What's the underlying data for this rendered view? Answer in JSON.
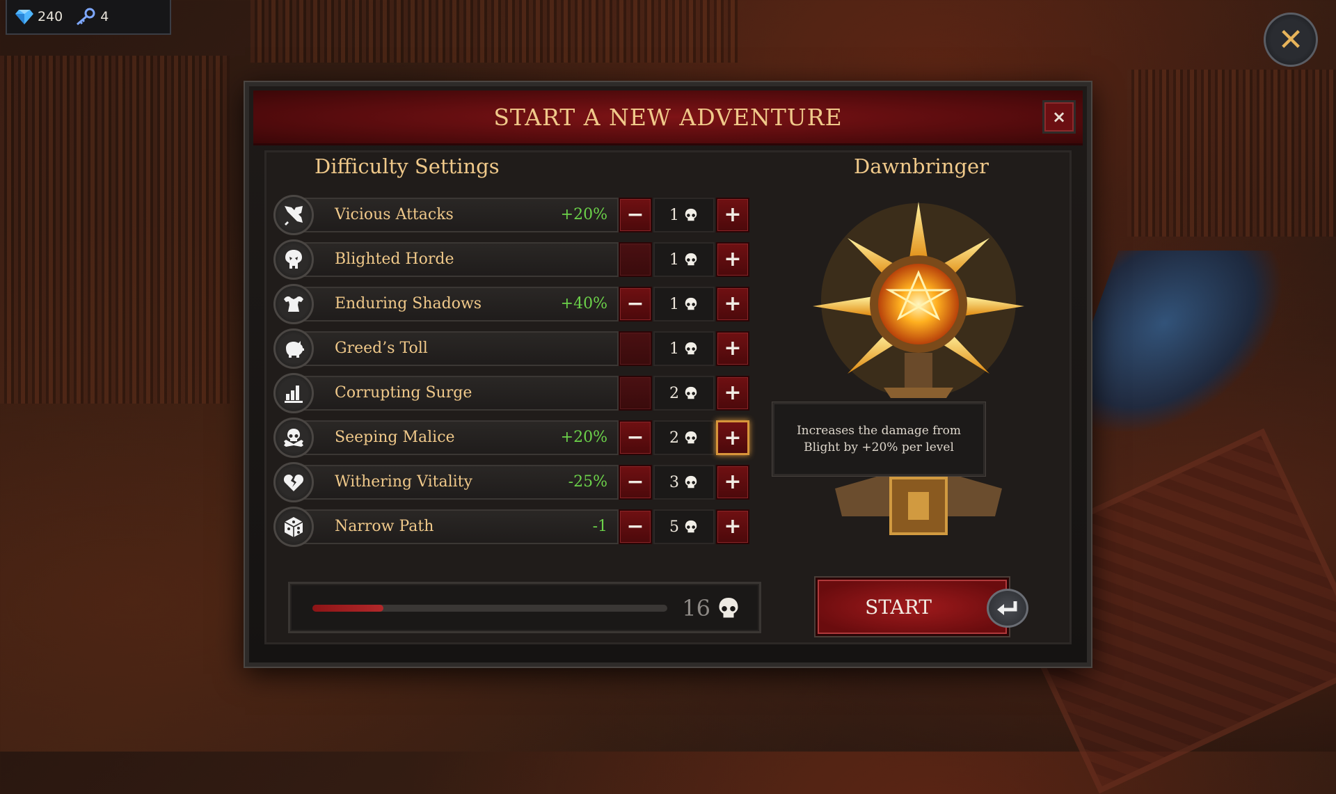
{
  "hud": {
    "gems": "240",
    "keys": "4"
  },
  "dialog": {
    "title": "START A NEW ADVENTURE",
    "close_label": "×",
    "difficulty_title": "Difficulty Settings",
    "artifact_title": "Dawnbringer",
    "tooltip": "Increases the damage from Blight by +20% per level",
    "total": "16",
    "progress": 0.2,
    "start_label": "START"
  },
  "outer_close_label": "✕",
  "settings": [
    {
      "icon": "crossed-swords-icon",
      "label": "Vicious Attacks",
      "value": "+20%",
      "level": "1",
      "minus_enabled": true,
      "selected": false
    },
    {
      "icon": "skull-mask-icon",
      "label": "Blighted Horde",
      "value": "",
      "level": "1",
      "minus_enabled": false,
      "selected": false
    },
    {
      "icon": "muscle-torso-icon",
      "label": "Enduring Shadows",
      "value": "+40%",
      "level": "1",
      "minus_enabled": true,
      "selected": false
    },
    {
      "icon": "piggy-bank-icon",
      "label": "Greed’s Toll",
      "value": "",
      "level": "1",
      "minus_enabled": false,
      "selected": false
    },
    {
      "icon": "bar-chart-icon",
      "label": "Corrupting Surge",
      "value": "",
      "level": "2",
      "minus_enabled": false,
      "selected": false
    },
    {
      "icon": "skull-crossbones-icon",
      "label": "Seeping Malice",
      "value": "+20%",
      "level": "2",
      "minus_enabled": true,
      "selected": true
    },
    {
      "icon": "broken-heart-icon",
      "label": "Withering Vitality",
      "value": "-25%",
      "level": "3",
      "minus_enabled": true,
      "selected": false
    },
    {
      "icon": "dice-icon",
      "label": "Narrow Path",
      "value": "-1",
      "level": "5",
      "minus_enabled": true,
      "selected": false
    }
  ],
  "colors": {
    "accent_gold": "#f0c98a",
    "positive": "#6cd24a",
    "crimson": "#7e1316"
  }
}
